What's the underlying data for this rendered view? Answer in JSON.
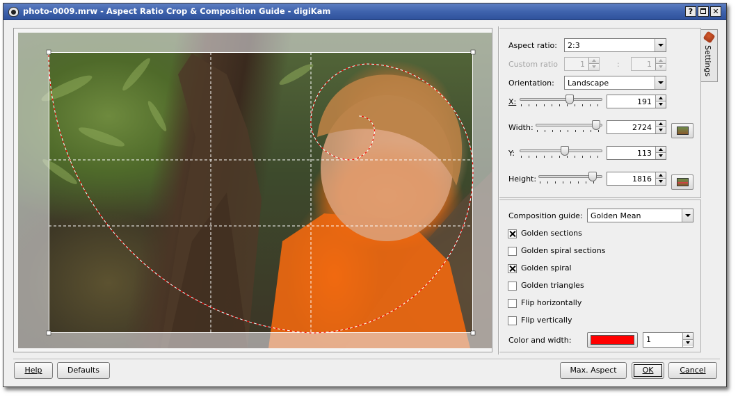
{
  "window": {
    "title": "photo-0009.mrw - Aspect Ratio Crop & Composition Guide - digiKam",
    "controls": {
      "help": "?",
      "maximize": "",
      "close": "✕"
    }
  },
  "settings_tab": {
    "label": "Settings",
    "icon": "wrench-icon"
  },
  "crop": {
    "aspect_ratio_label": "Aspect ratio:",
    "aspect_ratio_value": "2:3",
    "custom_ratio_label": "Custom ratio",
    "custom_ratio_a": "1",
    "custom_ratio_sep": ":",
    "custom_ratio_b": "1",
    "orientation_label": "Orientation:",
    "orientation_value": "Landscape",
    "x_label": "X:",
    "x_value": "191",
    "x_slider": 0.62,
    "width_label": "Width:",
    "width_value": "2724",
    "width_slider": 0.97,
    "y_label": "Y:",
    "y_value": "113",
    "y_slider": 0.55,
    "height_label": "Height:",
    "height_value": "1816",
    "height_slider": 0.9
  },
  "composition": {
    "guide_label": "Composition guide:",
    "guide_value": "Golden Mean",
    "options": [
      {
        "label": "Golden sections",
        "checked": true
      },
      {
        "label": "Golden spiral sections",
        "checked": false
      },
      {
        "label": "Golden spiral",
        "checked": true
      },
      {
        "label": "Golden triangles",
        "checked": false
      },
      {
        "label": "Flip horizontally",
        "checked": false
      },
      {
        "label": "Flip vertically",
        "checked": false
      }
    ],
    "color_width_label": "Color and width:",
    "guide_color": "#ff0000",
    "guide_width": "1"
  },
  "buttons": {
    "help": "Help",
    "defaults": "Defaults",
    "max_aspect": "Max. Aspect",
    "ok": "OK",
    "cancel": "Cancel"
  }
}
